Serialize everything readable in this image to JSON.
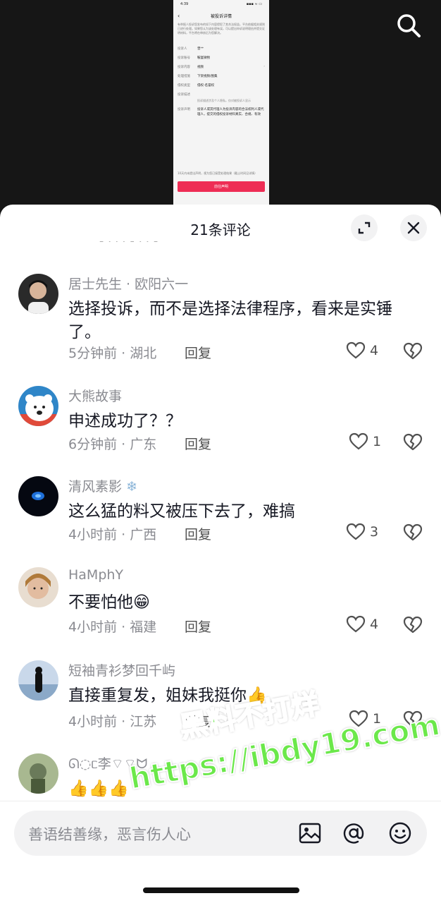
{
  "video": {
    "phone": {
      "time": "4:39",
      "status_right": "▪▪▪ ≈ ▭",
      "title": "被投诉详情",
      "intro": "有举报人投诉您发布的如下内容侵犯了其合法权益，平台依据相关规则已进行处理。如果您认为该处理有误，可以提出申诉说明理由并提交证明材料，平台将在审核后为您解决。",
      "rows": [
        {
          "k": "投诉人",
          "v": "曾**"
        },
        {
          "k": "投诉账号",
          "v": "鞍宴微物"
        },
        {
          "k": "投诉内容",
          "v": "视频"
        },
        {
          "k": "处理措施",
          "v": "下架视频/图集"
        },
        {
          "k": "侵权类型",
          "v": "侵权-名誉权"
        },
        {
          "k": "投诉描述",
          "v": ""
        }
      ],
      "note": "投诉描述涉及个人隐私，仅对被投诉人显示",
      "declaration_key": "投诉声明",
      "declaration": "投诉人或其代理人为投诉内容的合法权利人或代理人，提交的侵权投诉材料真实、合规、有效",
      "footer": "10天内未提出声明，视为您已接受处理结果（截止时间见详情）",
      "button": "前往声明"
    }
  },
  "sheet": {
    "title": "21条评论",
    "peek": "⁃ ‧ ‧ ‧ ⁃ ‧ ‧ ⁃"
  },
  "comments": [
    {
      "name": "居士先生 · 欧阳六一",
      "text": "选择投诉，而不是选择法律程序，看来是实锤了。",
      "meta": "5分钟前 · 湖北",
      "reply": "回复",
      "likes": "4",
      "avatar_color": "#3a3a3a"
    },
    {
      "name": "大熊故事",
      "text": "申述成功了？？",
      "meta": "6分钟前 · 广东",
      "reply": "回复",
      "likes": "1",
      "avatar_color": "#2f86c8"
    },
    {
      "name": "清风素影",
      "text": "这么猛的料又被压下去了，难搞",
      "meta": "4小时前 · 广西",
      "reply": "回复",
      "likes": "3",
      "avatar_color": "#050811"
    },
    {
      "name": "HaMphY",
      "text": "不要怕他😁",
      "meta": "4小时前 · 福建",
      "reply": "回复",
      "likes": "4",
      "avatar_color": "#c9a88a"
    },
    {
      "name": "短袖青衫梦回千屿",
      "text": "直接重复发，姐妹我挺你👍",
      "meta": "4小时前 · 江苏",
      "reply": "回复",
      "likes": "1",
      "avatar_color": "#8ba9c8"
    },
    {
      "name": "ᘏ◌ᥴ李⌔⌔ᗢ",
      "text": "👍👍👍",
      "avatar_color": "#6a7a5a"
    }
  ],
  "watermark": {
    "line1": "黑料不打烊",
    "line2": "https://ibdy19.com"
  },
  "input": {
    "placeholder": "善语结善缘，恶言伤人心"
  },
  "icons": {
    "search": "search-icon",
    "expand": "expand-icon",
    "close": "close-icon",
    "heart": "heart-icon",
    "broken_heart": "broken-heart-icon",
    "image": "image-icon",
    "at": "at-icon",
    "emoji": "emoji-icon"
  }
}
